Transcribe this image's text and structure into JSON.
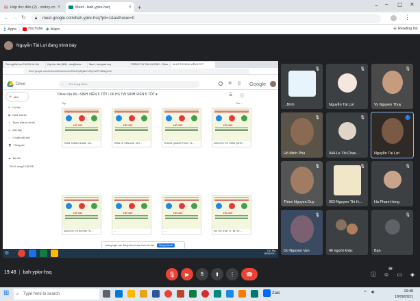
{
  "browser": {
    "tabs": [
      {
        "label": "Hộp thư đến (2) - xndxy-cntp1@..."
      },
      {
        "label": "Meet - bah-ypkx-hsq"
      }
    ],
    "new_tab": "+",
    "url": "meet.google.com/bah-ypkx-hsq?pli=1&authuser=0",
    "bookmarks": [
      {
        "label": "Apps"
      },
      {
        "label": "YouTube"
      },
      {
        "label": "Maps"
      }
    ],
    "reading_list": "Reading list"
  },
  "meet": {
    "presenter_label": "Nguyễn Tài Lợi đang trình bày",
    "meeting_time": "19:48",
    "meeting_code": "bah-ypkx-hsq",
    "participant_badge": "58",
    "participants": [
      {
        "name": "...Bình"
      },
      {
        "name": "Nguyễn Tài Lợi"
      },
      {
        "name": "Vy Nguyen Thuy"
      },
      {
        "name": "Hồ Minh Phú"
      },
      {
        "name": "044-Le Thi Chau ..."
      },
      {
        "name": "Nguyễn Tài Lợi"
      },
      {
        "name": "Thien Nguyen Duy"
      },
      {
        "name": "062-Nguyen Thi H..."
      },
      {
        "name": "Ha Pham Hong"
      },
      {
        "name": "Do Nguyen Van"
      },
      {
        "name": "46 người khác"
      },
      {
        "name": "Bạn"
      }
    ]
  },
  "shared_screen": {
    "inner_tabs": [
      {
        "label": "Trường Đại học Thủ Đô Hà Nội"
      },
      {
        "label": "Hộp thư đến (305) - nhu@tdmu..."
      },
      {
        "label": "Meet - bah-ypkx-hsq"
      },
      {
        "label": "TRÒNG THỊ THU HƯƠNG - Phiếu..."
      },
      {
        "label": "06 HS TW SINH VIÊN 5 TỐT"
      }
    ],
    "inner_url": "drive.google.com/drive/u/0/folders/1Zw9Hk4Hp5Q8kJ1JRpmWPC8Bappmfk",
    "drive_label": "Drive",
    "drive_search": "Tìm trong Drive",
    "google_word": "Google",
    "new_button": "Mới",
    "side_items": [
      {
        "label": "Ưu tiên"
      },
      {
        "label": "Drive của tôi"
      },
      {
        "label": "Được chia sẻ với tôi"
      },
      {
        "label": "Gần đây"
      },
      {
        "label": "Có gắn dấu sao"
      },
      {
        "label": "Thùng rác"
      },
      {
        "label": "Bộ nhớ"
      },
      {
        "label": "Đã sử dụng 13,08 GB"
      }
    ],
    "breadcrumb": "Drive của tôi  ›  SINH VIÊN 5 TỐT  ›  06 HS TW SINH VIÊN 5 TỐT  ▾",
    "column_header": "Tệp",
    "sort_label": "Tên ↓",
    "file_title": "HỒ SƠ",
    "files": [
      {
        "name": "TRẦN THANH NHÂN - BH..."
      },
      {
        "name": "TRẦN LÊ VĂN ANH - BH..."
      },
      {
        "name": "PHÙNG QUANG PHÚC - B..."
      },
      {
        "name": "NGUYỄN THỊ THẢO QUYÊ..."
      },
      {
        "name": "NGUYỄN THỊ HUỲNH TR..."
      },
      {
        "name": "..."
      },
      {
        "name": "..."
      },
      {
        "name": "HỒ THỊ THÙY H - BH TẾ..."
      }
    ],
    "share_notice": "meet.google.com đang chia sẻ màn hình của bạn",
    "stop_share": "Dừng chia sẻ",
    "inner_clock": "7:47 PM\n18/09/2021"
  },
  "taskbar": {
    "search_placeholder": "Type here to search",
    "clock_time": "19:48",
    "clock_date": "18/09/2021",
    "app_label": "Zalo"
  },
  "colors": {
    "meet_bg": "#202124",
    "tile_bg": "#3c4043",
    "hangup": "#ea4335",
    "accent": "#1a73e8"
  }
}
